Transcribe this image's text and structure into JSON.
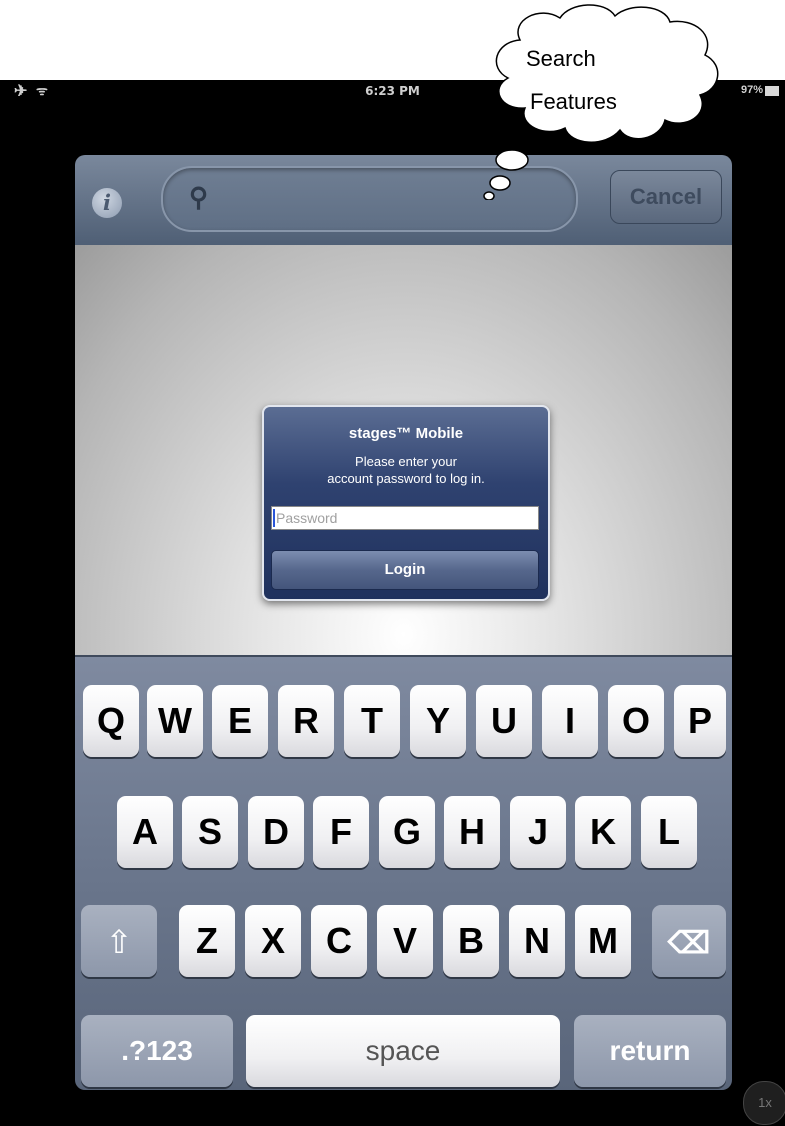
{
  "status_bar": {
    "airplane_icon": "airplane-icon",
    "wifi_icon": "wifi-icon",
    "time": "6:23 PM",
    "battery": "97%"
  },
  "toolbar": {
    "info_icon_glyph": "i",
    "search_icon": "search-icon",
    "search_placeholder": "",
    "cancel_label": "Cancel"
  },
  "dialog": {
    "title": "stages™ Mobile",
    "message_line1": "Please enter your",
    "message_line2": "account password to log in.",
    "password_placeholder": "Password",
    "login_label": "Login"
  },
  "keyboard": {
    "row1": [
      "Q",
      "W",
      "E",
      "R",
      "T",
      "Y",
      "U",
      "I",
      "O",
      "P"
    ],
    "row2": [
      "A",
      "S",
      "D",
      "F",
      "G",
      "H",
      "J",
      "K",
      "L"
    ],
    "row3": [
      "Z",
      "X",
      "C",
      "V",
      "B",
      "N",
      "M"
    ],
    "shift_icon": "shift-icon",
    "backspace_icon": "backspace-icon",
    "numbers_label": ".?123",
    "space_label": "space",
    "return_label": "return"
  },
  "annotation": {
    "line1": "Search",
    "line2": "Features"
  },
  "zoom_badge": "1x"
}
